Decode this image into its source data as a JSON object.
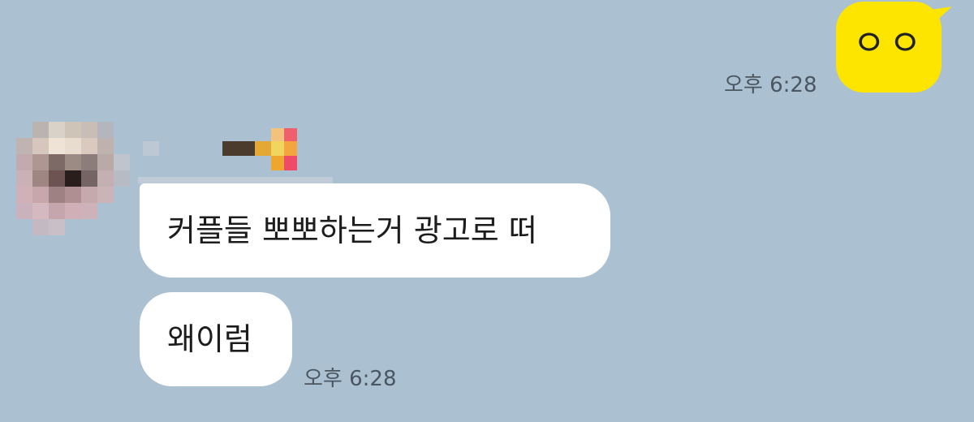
{
  "chat": {
    "outgoing": [
      {
        "text": "ㅇㅇ",
        "time": "오후 6:28"
      }
    ],
    "incoming": [
      {
        "text": "커플들 뽀뽀하는거 광고로 떠"
      },
      {
        "text": "왜이럼",
        "time": "오후 6:28"
      }
    ]
  },
  "colors": {
    "background": "#abc1d1",
    "outgoing_bubble": "#fee500",
    "incoming_bubble": "#ffffff",
    "timestamp": "#4a5661"
  },
  "icons": {
    "avatar": "pixelated-profile-avatar-icon",
    "sender_name": "pixelated-sender-name"
  }
}
